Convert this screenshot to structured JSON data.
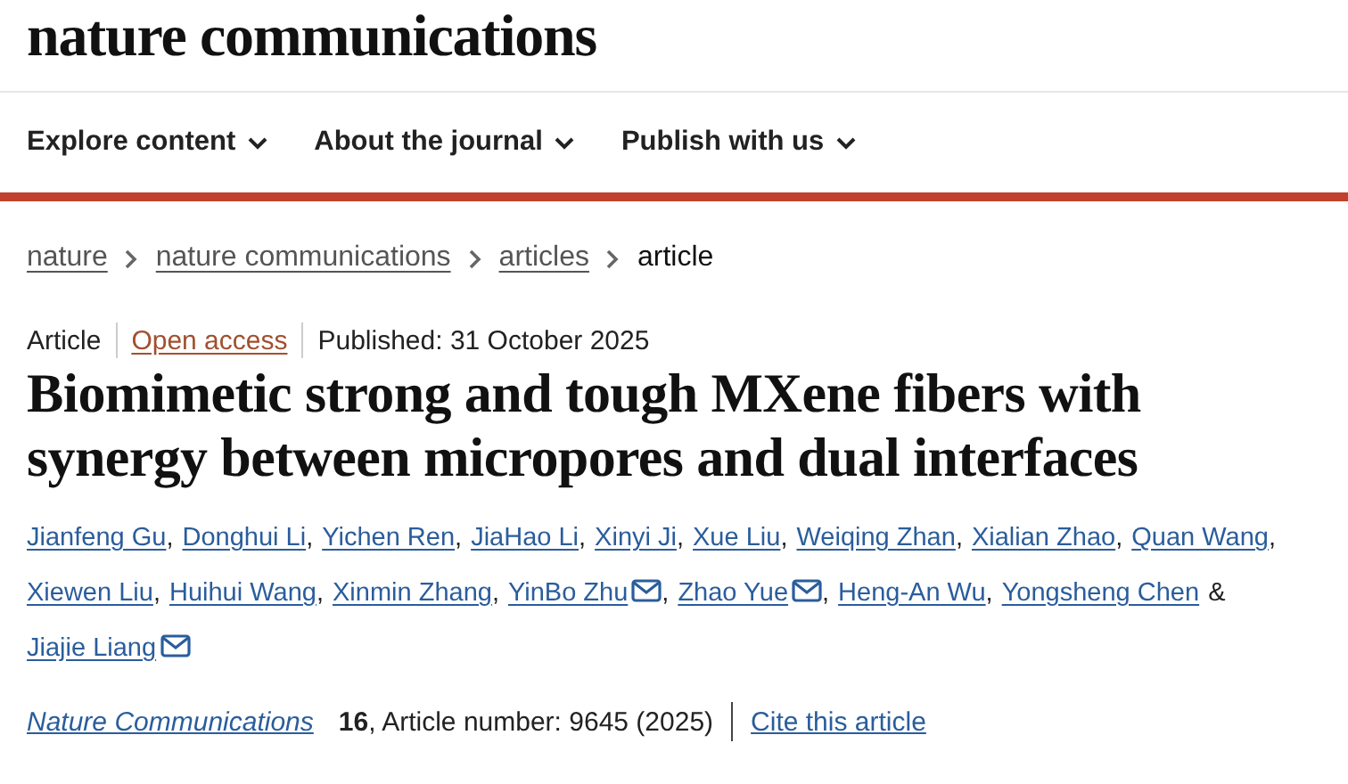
{
  "header": {
    "logo": "nature communications"
  },
  "nav": [
    {
      "label": "Explore content"
    },
    {
      "label": "About the journal"
    },
    {
      "label": "Publish with us"
    }
  ],
  "breadcrumbs": [
    {
      "label": "nature",
      "link": true
    },
    {
      "label": "nature communications",
      "link": true
    },
    {
      "label": "articles",
      "link": true
    },
    {
      "label": "article",
      "link": false
    }
  ],
  "article": {
    "type": "Article",
    "access": "Open access",
    "published": "Published: 31 October 2025",
    "title": "Biomimetic strong and tough MXene fibers with synergy between micropores and dual interfaces",
    "authors": [
      {
        "name": "Jianfeng Gu",
        "email": false,
        "after": ","
      },
      {
        "name": "Donghui Li",
        "email": false,
        "after": ","
      },
      {
        "name": "Yichen Ren",
        "email": false,
        "after": ","
      },
      {
        "name": "JiaHao Li",
        "email": false,
        "after": ","
      },
      {
        "name": "Xinyi Ji",
        "email": false,
        "after": ","
      },
      {
        "name": "Xue Liu",
        "email": false,
        "after": ","
      },
      {
        "name": "Weiqing Zhan",
        "email": false,
        "after": ","
      },
      {
        "name": "Xialian Zhao",
        "email": false,
        "after": ","
      },
      {
        "name": "Quan Wang",
        "email": false,
        "after": ","
      },
      {
        "name": "Xiewen Liu",
        "email": false,
        "after": ","
      },
      {
        "name": "Huihui Wang",
        "email": false,
        "after": ","
      },
      {
        "name": "Xinmin Zhang",
        "email": false,
        "after": ","
      },
      {
        "name": "YinBo Zhu",
        "email": true,
        "after": ","
      },
      {
        "name": "Zhao Yue",
        "email": true,
        "after": ","
      },
      {
        "name": "Heng-An Wu",
        "email": false,
        "after": ","
      },
      {
        "name": "Yongsheng Chen",
        "email": false,
        "after": "&"
      },
      {
        "name": "Jiajie Liang",
        "email": true
      }
    ],
    "journal": "Nature Communications",
    "volume": "16",
    "article_number": ", Article number: 9645 (2025)",
    "cite": "Cite this article"
  }
}
